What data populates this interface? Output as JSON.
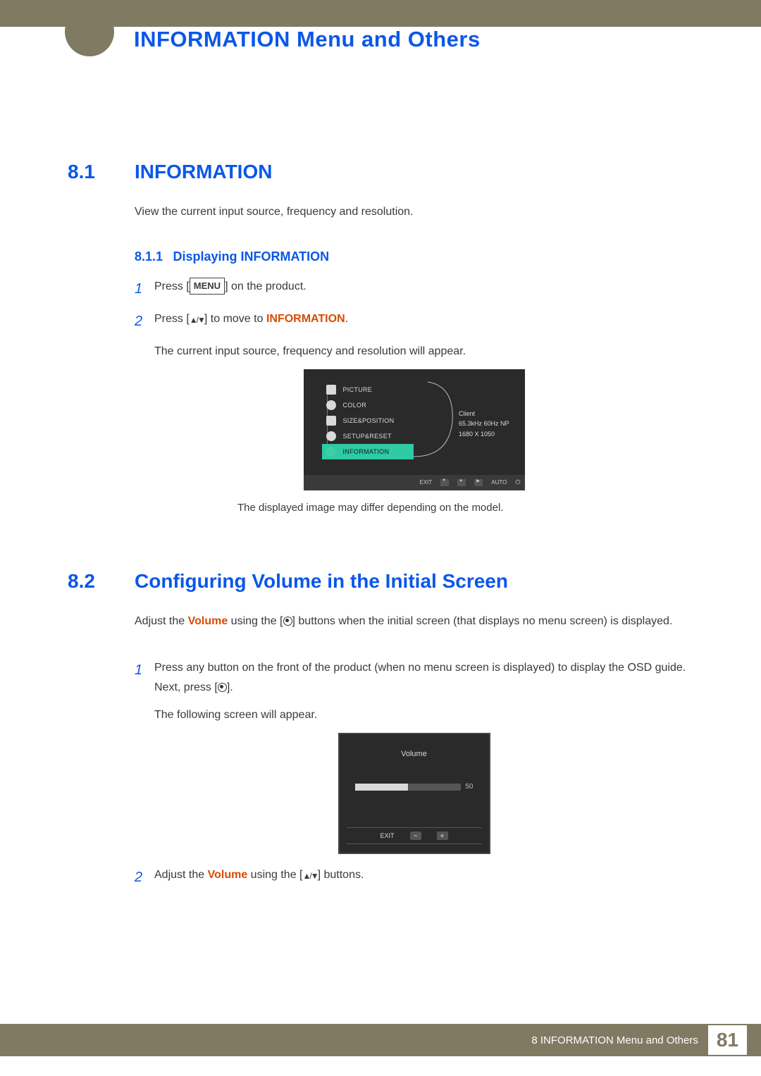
{
  "chapter_title": "INFORMATION Menu and Others",
  "sec1": {
    "num": "8.1",
    "title": "INFORMATION"
  },
  "para1": "View the current input source, frequency and resolution.",
  "subsec1": {
    "num": "8.1.1",
    "title": "Displaying INFORMATION"
  },
  "step1_1a": "Press [",
  "menu_label": "MENU",
  "step1_1b": "] on the product.",
  "step1_2a": "Press [",
  "step1_2b": "] to move to ",
  "kw_information": "INFORMATION",
  "step1_2c": ".",
  "step1_cont": "The current input source, frequency and resolution will appear.",
  "osd1": {
    "items": [
      "PICTURE",
      "COLOR",
      "SIZE&POSITION",
      "SETUP&RESET",
      "INFORMATION"
    ],
    "info_client": "Client",
    "info_freq": "65.3kHz 60Hz NP",
    "info_res": "1680 X 1050",
    "bottom_exit": "EXIT",
    "bottom_auto": "AUTO"
  },
  "caption1": "The displayed image may differ depending on the model.",
  "sec2": {
    "num": "8.2",
    "title": "Configuring Volume in the Initial Screen"
  },
  "para2a": "Adjust the ",
  "kw_volume": "Volume",
  "para2b": " using the [",
  "para2c": "] buttons when the initial screen (that displays no menu screen) is displayed.",
  "step2_1a": "Press any button on the front of the product (when no menu screen is displayed) to display the OSD guide. Next, press [",
  "step2_1b": "].",
  "step2_1c": "The following screen will appear.",
  "osd2": {
    "title": "Volume",
    "value": "50",
    "exit": "EXIT"
  },
  "step2_2a": "Adjust the ",
  "step2_2b": " using the [",
  "step2_2c": "] buttons.",
  "footer": {
    "text": "8 INFORMATION Menu and Others",
    "page": "81"
  },
  "step_nums": {
    "one": "1",
    "two": "2"
  }
}
